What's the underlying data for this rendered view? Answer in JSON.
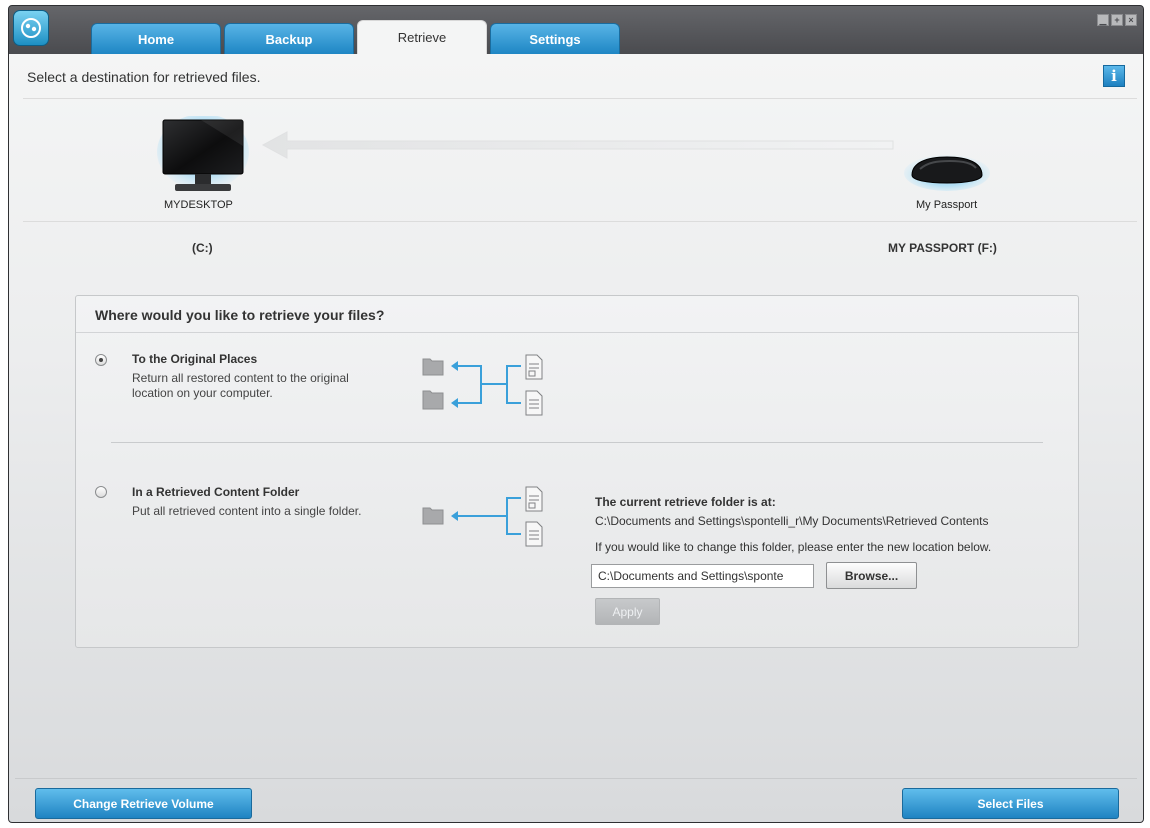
{
  "tabs": [
    {
      "label": "Home",
      "active": false
    },
    {
      "label": "Backup",
      "active": false
    },
    {
      "label": "Retrieve",
      "active": true
    },
    {
      "label": "Settings",
      "active": false
    }
  ],
  "header": {
    "instruction": "Select a destination for retrieved files.",
    "info_icon": "i"
  },
  "devices": {
    "source": {
      "name": "MYDESKTOP",
      "volume": "(C:)",
      "icon": "monitor-icon"
    },
    "target": {
      "name": "My Passport",
      "volume": "MY PASSPORT (F:)",
      "icon": "external-drive-icon"
    }
  },
  "panel": {
    "title": "Where would you like to retrieve your files?",
    "option_original": {
      "title": "To the Original Places",
      "description": "Return all restored content to the original location on your computer.",
      "selected": true
    },
    "option_folder": {
      "title": "In a Retrieved Content Folder",
      "description": "Put all retrieved content into a single folder.",
      "selected": false,
      "current_label": "The current retrieve folder is at:",
      "current_path": "C:\\Documents and Settings\\spontelli_r\\My Documents\\Retrieved Contents",
      "change_hint": "If you would like to change this folder, please enter the new location below.",
      "input_value": "C:\\Documents and Settings\\sponte",
      "browse_label": "Browse...",
      "apply_label": "Apply"
    }
  },
  "footer": {
    "change_volume_label": "Change Retrieve Volume",
    "select_files_label": "Select Files"
  },
  "colors": {
    "accent": "#2a93d0",
    "diagram_line": "#3aa0da",
    "titlebar": "#55565a"
  }
}
